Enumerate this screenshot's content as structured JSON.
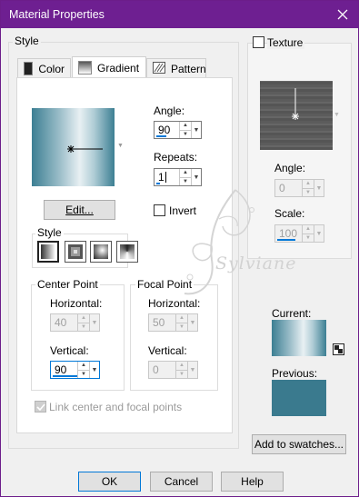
{
  "window": {
    "title": "Material Properties"
  },
  "style_group": {
    "label": "Style"
  },
  "tabs": [
    {
      "label": "Color",
      "icon": "color-swatch-icon"
    },
    {
      "label": "Gradient",
      "icon": "gradient-icon"
    },
    {
      "label": "Pattern",
      "icon": "pattern-icon"
    }
  ],
  "gradient": {
    "angle_label": "Angle:",
    "angle_value": "90",
    "repeats_label": "Repeats:",
    "repeats_value": "1",
    "edit_button": "Edit...",
    "invert_label": "Invert",
    "invert_checked": false,
    "style_label": "Style",
    "style_types": [
      "linear-gradient-icon",
      "rectangular-gradient-icon",
      "sunburst-gradient-icon",
      "radial-gradient-icon"
    ]
  },
  "center_point": {
    "label": "Center Point",
    "horizontal_label": "Horizontal:",
    "horizontal_value": "40",
    "vertical_label": "Vertical:",
    "vertical_value": "90"
  },
  "focal_point": {
    "label": "Focal Point",
    "horizontal_label": "Horizontal:",
    "horizontal_value": "50",
    "vertical_label": "Vertical:",
    "vertical_value": "0"
  },
  "link_label": "Link center and focal points",
  "texture": {
    "label": "Texture",
    "checked": false,
    "angle_label": "Angle:",
    "angle_value": "0",
    "scale_label": "Scale:",
    "scale_value": "100"
  },
  "current_label": "Current:",
  "previous_label": "Previous:",
  "add_swatches_button": "Add to swatches...",
  "buttons": {
    "ok": "OK",
    "cancel": "Cancel",
    "help": "Help"
  },
  "watermark": "Sylviane",
  "colors": {
    "title_bar": "#6e1f91",
    "gradient_dark": "#3c7f93",
    "gradient_light": "#e8f0f3",
    "previous_swatch": "#3a7a8e",
    "accent": "#0078d7"
  }
}
